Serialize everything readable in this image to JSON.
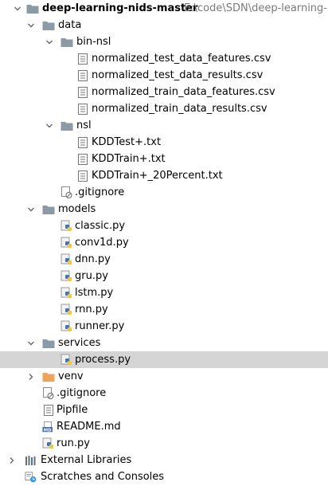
{
  "tree": {
    "root": {
      "name": "deep-learning-nids-master",
      "path": "E:\\code\\SDN\\deep-learning-nids-master"
    },
    "data_folder": {
      "name": "data"
    },
    "bin_nsl_folder": {
      "name": "bin-nsl"
    },
    "bin_nsl_files": [
      {
        "name": "normalized_test_data_features.csv"
      },
      {
        "name": "normalized_test_data_results.csv"
      },
      {
        "name": "normalized_train_data_features.csv"
      },
      {
        "name": "normalized_train_data_results.csv"
      }
    ],
    "nsl_folder": {
      "name": "nsl"
    },
    "nsl_files": [
      {
        "name": "KDDTest+.txt"
      },
      {
        "name": "KDDTrain+.txt"
      },
      {
        "name": "KDDTrain+_20Percent.txt"
      }
    ],
    "data_gitignore": {
      "name": ".gitignore"
    },
    "models_folder": {
      "name": "models"
    },
    "model_files": [
      {
        "name": "classic.py"
      },
      {
        "name": "conv1d.py"
      },
      {
        "name": "dnn.py"
      },
      {
        "name": "gru.py"
      },
      {
        "name": "lstm.py"
      },
      {
        "name": "rnn.py"
      },
      {
        "name": "runner.py"
      }
    ],
    "services_folder": {
      "name": "services"
    },
    "services_files": [
      {
        "name": "process.py"
      }
    ],
    "venv_folder": {
      "name": "venv"
    },
    "root_files": [
      {
        "name": ".gitignore",
        "icon": "gitignore-file-icon"
      },
      {
        "name": "Pipfile",
        "icon": "text-file-icon"
      },
      {
        "name": "README.md",
        "icon": "markdown-file-icon"
      },
      {
        "name": "run.py",
        "icon": "python-file-icon"
      }
    ],
    "external_libraries": {
      "name": "External Libraries"
    },
    "scratches": {
      "name": "Scratches and Consoles"
    }
  },
  "colors": {
    "folder": "#8c9aa6",
    "venv_folder": "#f0a35a",
    "selection": "#d5d5d5",
    "path_text": "#7a7a7a",
    "python_blue": "#3b77b8",
    "python_yellow": "#f4c63d"
  }
}
